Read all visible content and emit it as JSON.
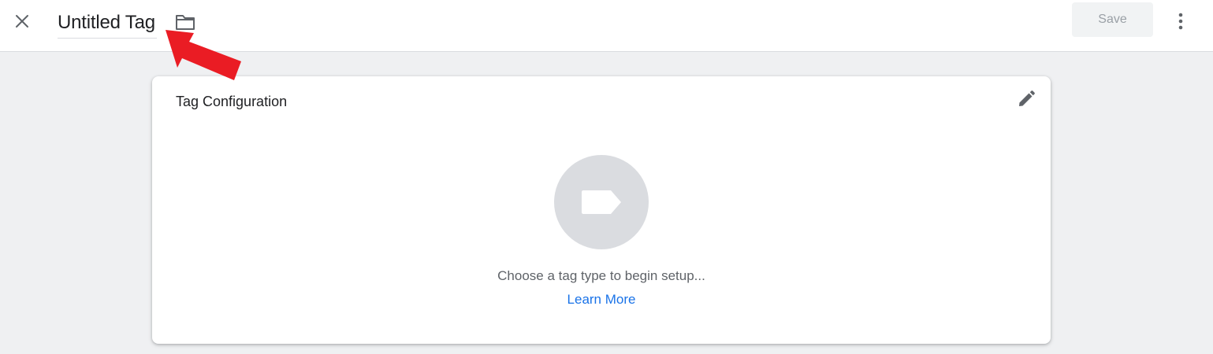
{
  "header": {
    "close_icon": "close-icon",
    "title": "Untitled Tag",
    "folder_icon": "folder-icon",
    "save_label": "Save",
    "more_icon": "more-vert-icon"
  },
  "card": {
    "title": "Tag Configuration",
    "edit_icon": "pencil-icon",
    "tag_icon": "tag-label-icon",
    "hint": "Choose a tag type to begin setup...",
    "learn_more": "Learn More"
  },
  "annotation": {
    "arrow_color": "#ea1c24"
  },
  "colors": {
    "accent_link": "#1a73e8",
    "background": "#eff0f2",
    "icon_gray": "#5f6368",
    "placeholder_circle": "#dadce0"
  }
}
